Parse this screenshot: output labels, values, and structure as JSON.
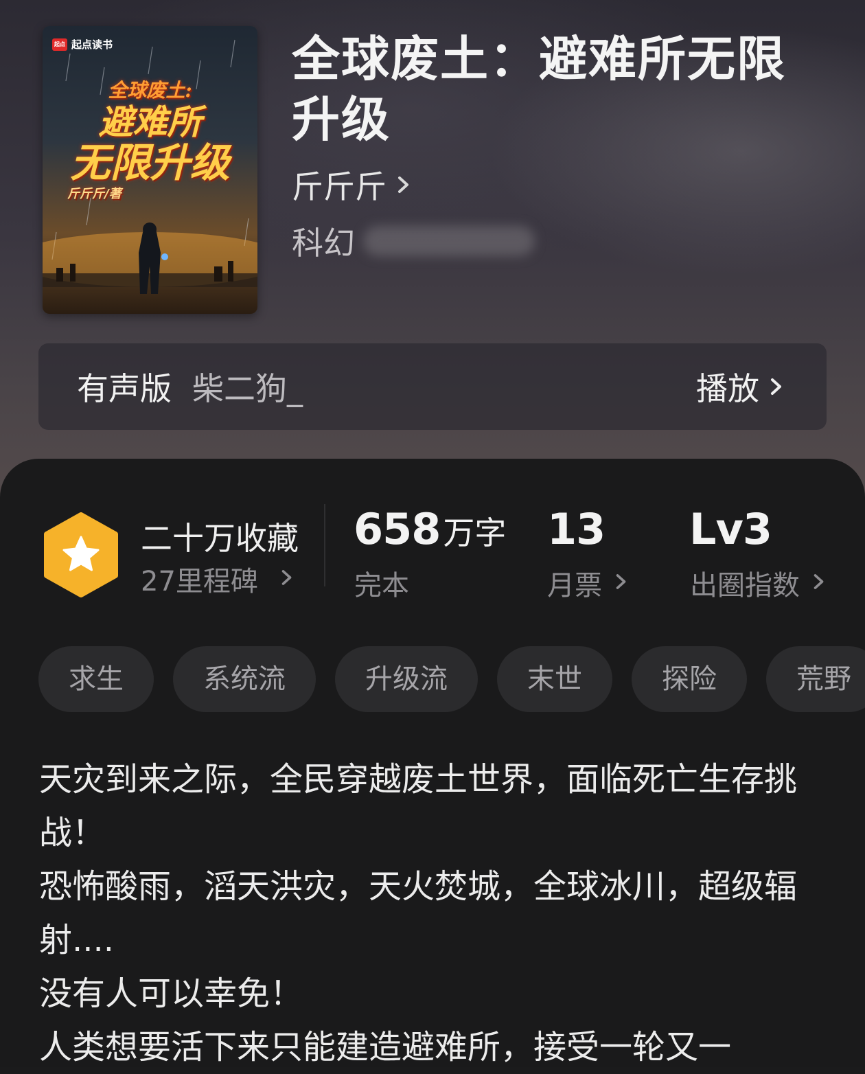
{
  "book": {
    "title": "全球废土：避难所无限升级",
    "author": "斤斤斤",
    "category": "科幻"
  },
  "cover": {
    "brand": "起点读书",
    "brand_logo": "起点",
    "title_line1": "全球废土:",
    "title_line2": "避难所",
    "title_line3": "无限升级",
    "author_line": "斤斤斤/著"
  },
  "audio": {
    "label": "有声版",
    "narrator": "柴二狗_",
    "play_label": "播放"
  },
  "stats": {
    "milestone_title": "二十万收藏",
    "milestone_sub": "27里程碑",
    "words_value": "658",
    "words_unit": "万字",
    "words_status": "完本",
    "monthly_votes": "13",
    "monthly_votes_label": "月票",
    "level": "Lv3",
    "level_label": "出圈指数"
  },
  "tags": [
    "求生",
    "系统流",
    "升级流",
    "末世",
    "探险",
    "荒野"
  ],
  "synopsis": [
    "天灾到来之际，全民穿越废土世界，面临死亡生存挑战！",
    "恐怖酸雨，滔天洪灾，天火焚城，全球冰川，超级辐射....",
    "没有人可以幸免！",
    "人类想要活下来只能建造避难所，接受一轮又一"
  ],
  "colors": {
    "badge_gold": "#f6b22a",
    "panel_bg": "#1a1a1b",
    "tag_bg": "#2b2b2d"
  },
  "icons": [
    "chevron-right-icon",
    "star-badge-icon",
    "blurred-tag"
  ]
}
